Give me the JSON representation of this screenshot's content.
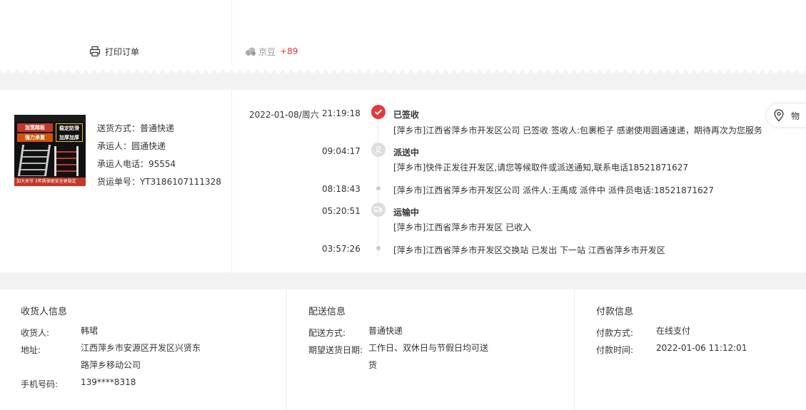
{
  "top": {
    "print_label": "打印订单",
    "jingdou_label": "京豆",
    "jingdou_value": "+89"
  },
  "product": {
    "image_text_1": "加宽踏板",
    "image_text_2": "强力承重",
    "image_text_3": "稳定防滑 加厚加厚",
    "image_bottom_text": "加大关节 3年质保更安全更稳定"
  },
  "shipping": {
    "method": "送货方式：普通快递",
    "carrier": "承运人：圆通快递",
    "carrier_phone": "承运人电话：95554",
    "tracking_no": "货运单号：YT3186107111328"
  },
  "timeline": [
    {
      "date": "2022-01-08/周六",
      "time": "21:19:18",
      "status": "已签收",
      "desc": "[萍乡市]江西省萍乡市开发区公司 已签收 签收人:包裹柜子 感谢使用圆通速递，期待再次为您服务",
      "icon": "check-icon"
    },
    {
      "date": "",
      "time": "09:04:17",
      "status": "派送中",
      "desc": "[萍乡市]快件正发往开发区,请您等候取件或派送通知,联系电话18521871627",
      "icon": "courier-icon"
    },
    {
      "date": "",
      "time": "08:18:43",
      "status": "",
      "desc": "[萍乡市]江西省萍乡市开发区公司 派件人:王禹成 派件中 派件员电话:18521871627",
      "icon": "dot-icon"
    },
    {
      "date": "",
      "time": "05:20:51",
      "status": "运输中",
      "desc": "[萍乡市]江西省萍乡市开发区 已收入",
      "icon": "truck-icon"
    },
    {
      "date": "",
      "time": "03:57:26",
      "status": "",
      "desc": "[萍乡市]江西省萍乡市开发区交换站 已发出 下一站 江西省萍乡市开发区",
      "icon": "dot-icon"
    }
  ],
  "float_button": {
    "label": "物"
  },
  "receiver": {
    "title": "收货人信息",
    "name_label": "收货人:",
    "name_value": "韩珺",
    "address_label": "地址:",
    "address_line1": "江西萍乡市安源区开发区兴贤东",
    "address_line2": "路萍乡移动公司",
    "phone_label": "手机号码:",
    "phone_value": "139****8318"
  },
  "delivery": {
    "title": "配送信息",
    "method_label": "配送方式:",
    "method_value": "普通快递",
    "date_label": "期望送货日期:",
    "date_line1": "工作日、双休日与节假日均可送",
    "date_line2": "货"
  },
  "payment": {
    "title": "付款信息",
    "method_label": "付款方式:",
    "method_value": "在线支付",
    "time_label": "付款时间:",
    "time_value": "2022-01-06 11:12:01"
  },
  "colors": {
    "accent": "#e4393c",
    "background": "#f3f3f3",
    "text": "#333333",
    "muted": "#999999"
  }
}
